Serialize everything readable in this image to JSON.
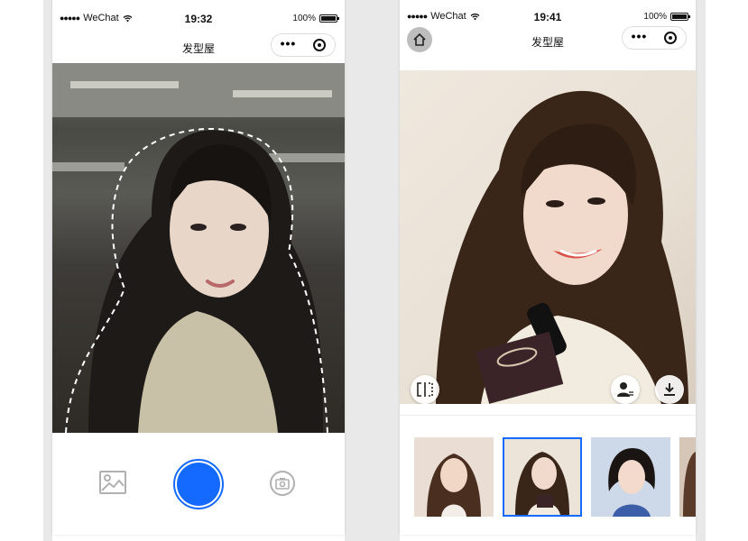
{
  "left_screen": {
    "status": {
      "carrier": "WeChat",
      "time": "19:32",
      "battery": "100%"
    },
    "nav": {
      "title": "发型屋",
      "more_icon": "more-dots-icon",
      "close_icon": "target-icon"
    },
    "toolbar": {
      "gallery_icon": "image-icon",
      "shutter_color": "#1469ff",
      "switch_camera_icon": "camera-switch-icon"
    }
  },
  "right_screen": {
    "status": {
      "carrier": "WeChat",
      "time": "19:41",
      "battery": "100%"
    },
    "nav": {
      "title": "发型屋",
      "home_icon": "home-icon",
      "more_icon": "more-dots-icon",
      "close_icon": "target-icon"
    },
    "photo_actions": {
      "compare_icon": "compare-split-icon",
      "swap_face_icon": "person-swap-icon",
      "download_icon": "download-icon"
    },
    "thumbnails": [
      {
        "selected": false
      },
      {
        "selected": true
      },
      {
        "selected": false
      },
      {
        "selected": false
      }
    ],
    "accent": "#1469ff"
  }
}
